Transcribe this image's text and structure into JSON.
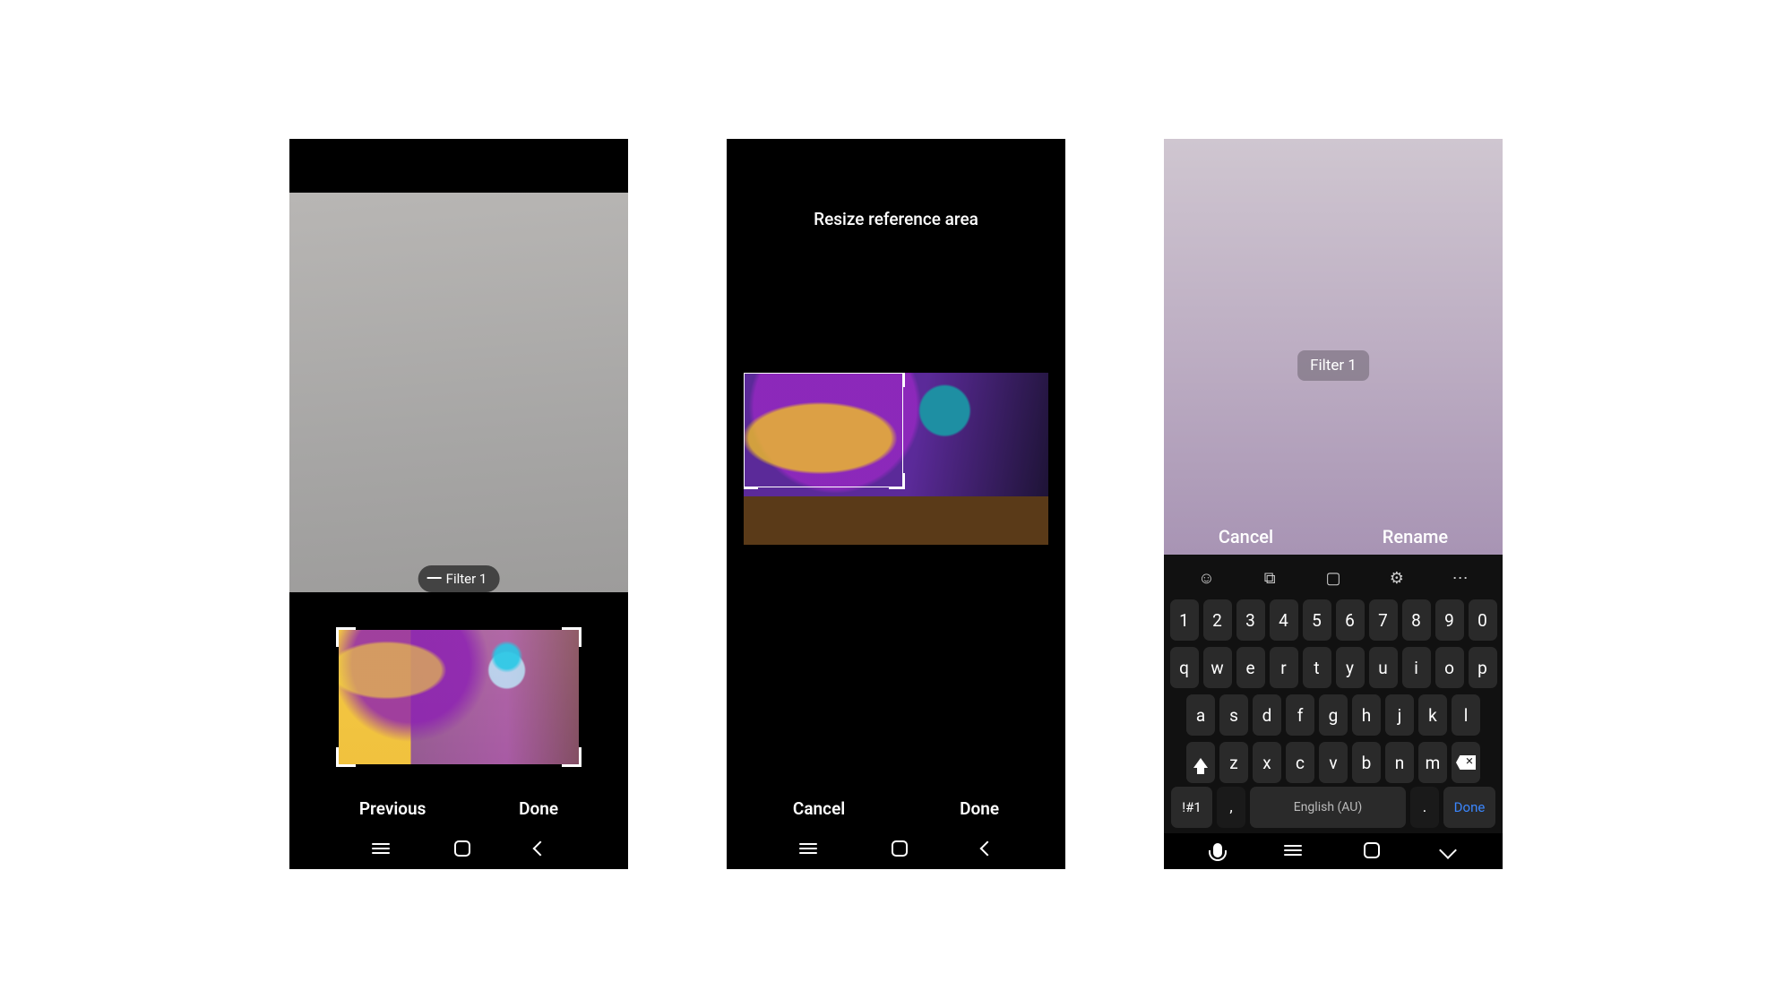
{
  "screen1": {
    "filter_pill": "Filter 1",
    "previous": "Previous",
    "done": "Done"
  },
  "screen2": {
    "title": "Resize reference area",
    "cancel": "Cancel",
    "done": "Done"
  },
  "screen3": {
    "filter_pill": "Filter 1",
    "cancel": "Cancel",
    "rename": "Rename",
    "keyboard": {
      "row_nums": [
        "1",
        "2",
        "3",
        "4",
        "5",
        "6",
        "7",
        "8",
        "9",
        "0"
      ],
      "row1": [
        "q",
        "w",
        "e",
        "r",
        "t",
        "y",
        "u",
        "i",
        "o",
        "p"
      ],
      "row2": [
        "a",
        "s",
        "d",
        "f",
        "g",
        "h",
        "j",
        "k",
        "l"
      ],
      "row3": [
        "z",
        "x",
        "c",
        "v",
        "b",
        "n",
        "m"
      ],
      "symbol_key": "!#1",
      "comma": ",",
      "period": ".",
      "space_label": "English (AU)",
      "done": "Done"
    }
  }
}
